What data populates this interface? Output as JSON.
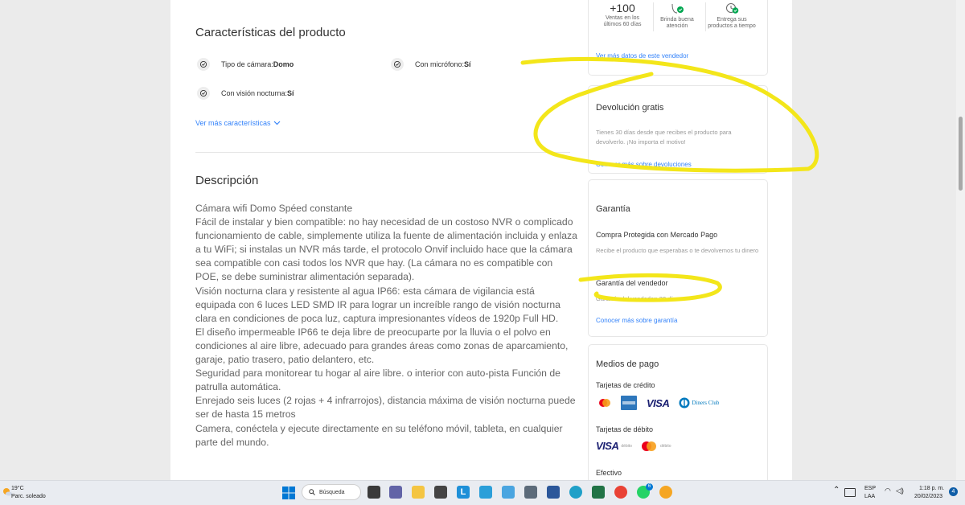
{
  "features": {
    "title": "Características del producto",
    "items": [
      {
        "label": "Tipo de cámara: ",
        "value": "Domo"
      },
      {
        "label": "Con micrófono: ",
        "value": "Sí"
      },
      {
        "label": "Con visión nocturna: ",
        "value": "Sí"
      }
    ],
    "more_link": "Ver más características"
  },
  "description": {
    "title": "Descripción",
    "text": "Cámara wifi Domo Spéed constante\nFácil de instalar y bien compatible: no hay necesidad de un costoso NVR o complicado funcionamiento de cable, simplemente utiliza la fuente de alimentación incluida y enlaza a tu WiFi; si instalas un NVR más tarde, el protocolo Onvif incluido hace que la cámara sea compatible con casi todos los NVR que hay. (La cámara no es compatible con POE, se debe suministrar alimentación separada).\nVisión nocturna clara y resistente al agua IP66: esta cámara de vigilancia está equipada con 6 luces LED SMD IR para lograr un increíble rango de visión nocturna clara en condiciones de poca luz, captura impresionantes vídeos de 1920p Full HD.\nEl diseño impermeable IP66 te deja libre de preocuparte por la lluvia o el polvo en condiciones al aire libre, adecuado para grandes áreas como zonas de aparcamiento, garaje, patio trasero, patio delantero, etc.\nSeguridad para monitorear tu hogar al aire libre. o interior con auto-pista Función de patrulla automática.\nEnrejado seis luces (2 rojas + 4 infrarrojos), distancia máxima de visión nocturna puede ser de hasta 15 metros\nCamera, conéctela y ejecute directamente en su teléfono móvil, tableta, en cualquier parte del mundo."
  },
  "seller": {
    "stats": [
      {
        "big": "+100",
        "text": "Ventas en los últimos 60 días",
        "icon": "sales-count"
      },
      {
        "big": "",
        "text": "Brinda buena atención",
        "icon": "good-attention-icon"
      },
      {
        "big": "",
        "text": "Entrega sus productos a tiempo",
        "icon": "on-time-delivery-icon"
      }
    ],
    "more_link": "Ver más datos de este vendedor"
  },
  "returns": {
    "title": "Devolución gratis",
    "text": "Tienes 30 días desde que recibes el producto para devolverlo. ¡No importa el motivo!",
    "link": "Conocer más sobre devoluciones"
  },
  "warranty": {
    "title": "Garantía",
    "protected_title": "Compra Protegida con Mercado Pago",
    "protected_text": "Recibe el producto que esperabas o te devolvemos tu dinero",
    "seller_title": "Garantía del vendedor",
    "seller_text": "Garantía del vendedor: 30 días",
    "link": "Conocer más sobre garantía"
  },
  "payment": {
    "title": "Medios de pago",
    "credit_title": "Tarjetas de crédito",
    "credit_brands": [
      "mastercard-logo",
      "amex-logo",
      "VISA",
      "Diners Club"
    ],
    "debit_title": "Tarjetas de débito",
    "debit_brands": [
      "VISA",
      "débito",
      "débito"
    ],
    "cash_title": "Efectivo"
  },
  "taskbar": {
    "weather_temp": "19°C",
    "weather_desc": "Parc. soleado",
    "search_label": "Búsqueda",
    "lang_top": "ESP",
    "lang_bottom": "LAA",
    "time": "1:18 p. m.",
    "date": "20/02/2023",
    "notif_count": "4",
    "badge_count": "6"
  },
  "colors": {
    "link": "#3483fa",
    "highlight": "#f3e61a",
    "seller_green": "#00a650"
  }
}
